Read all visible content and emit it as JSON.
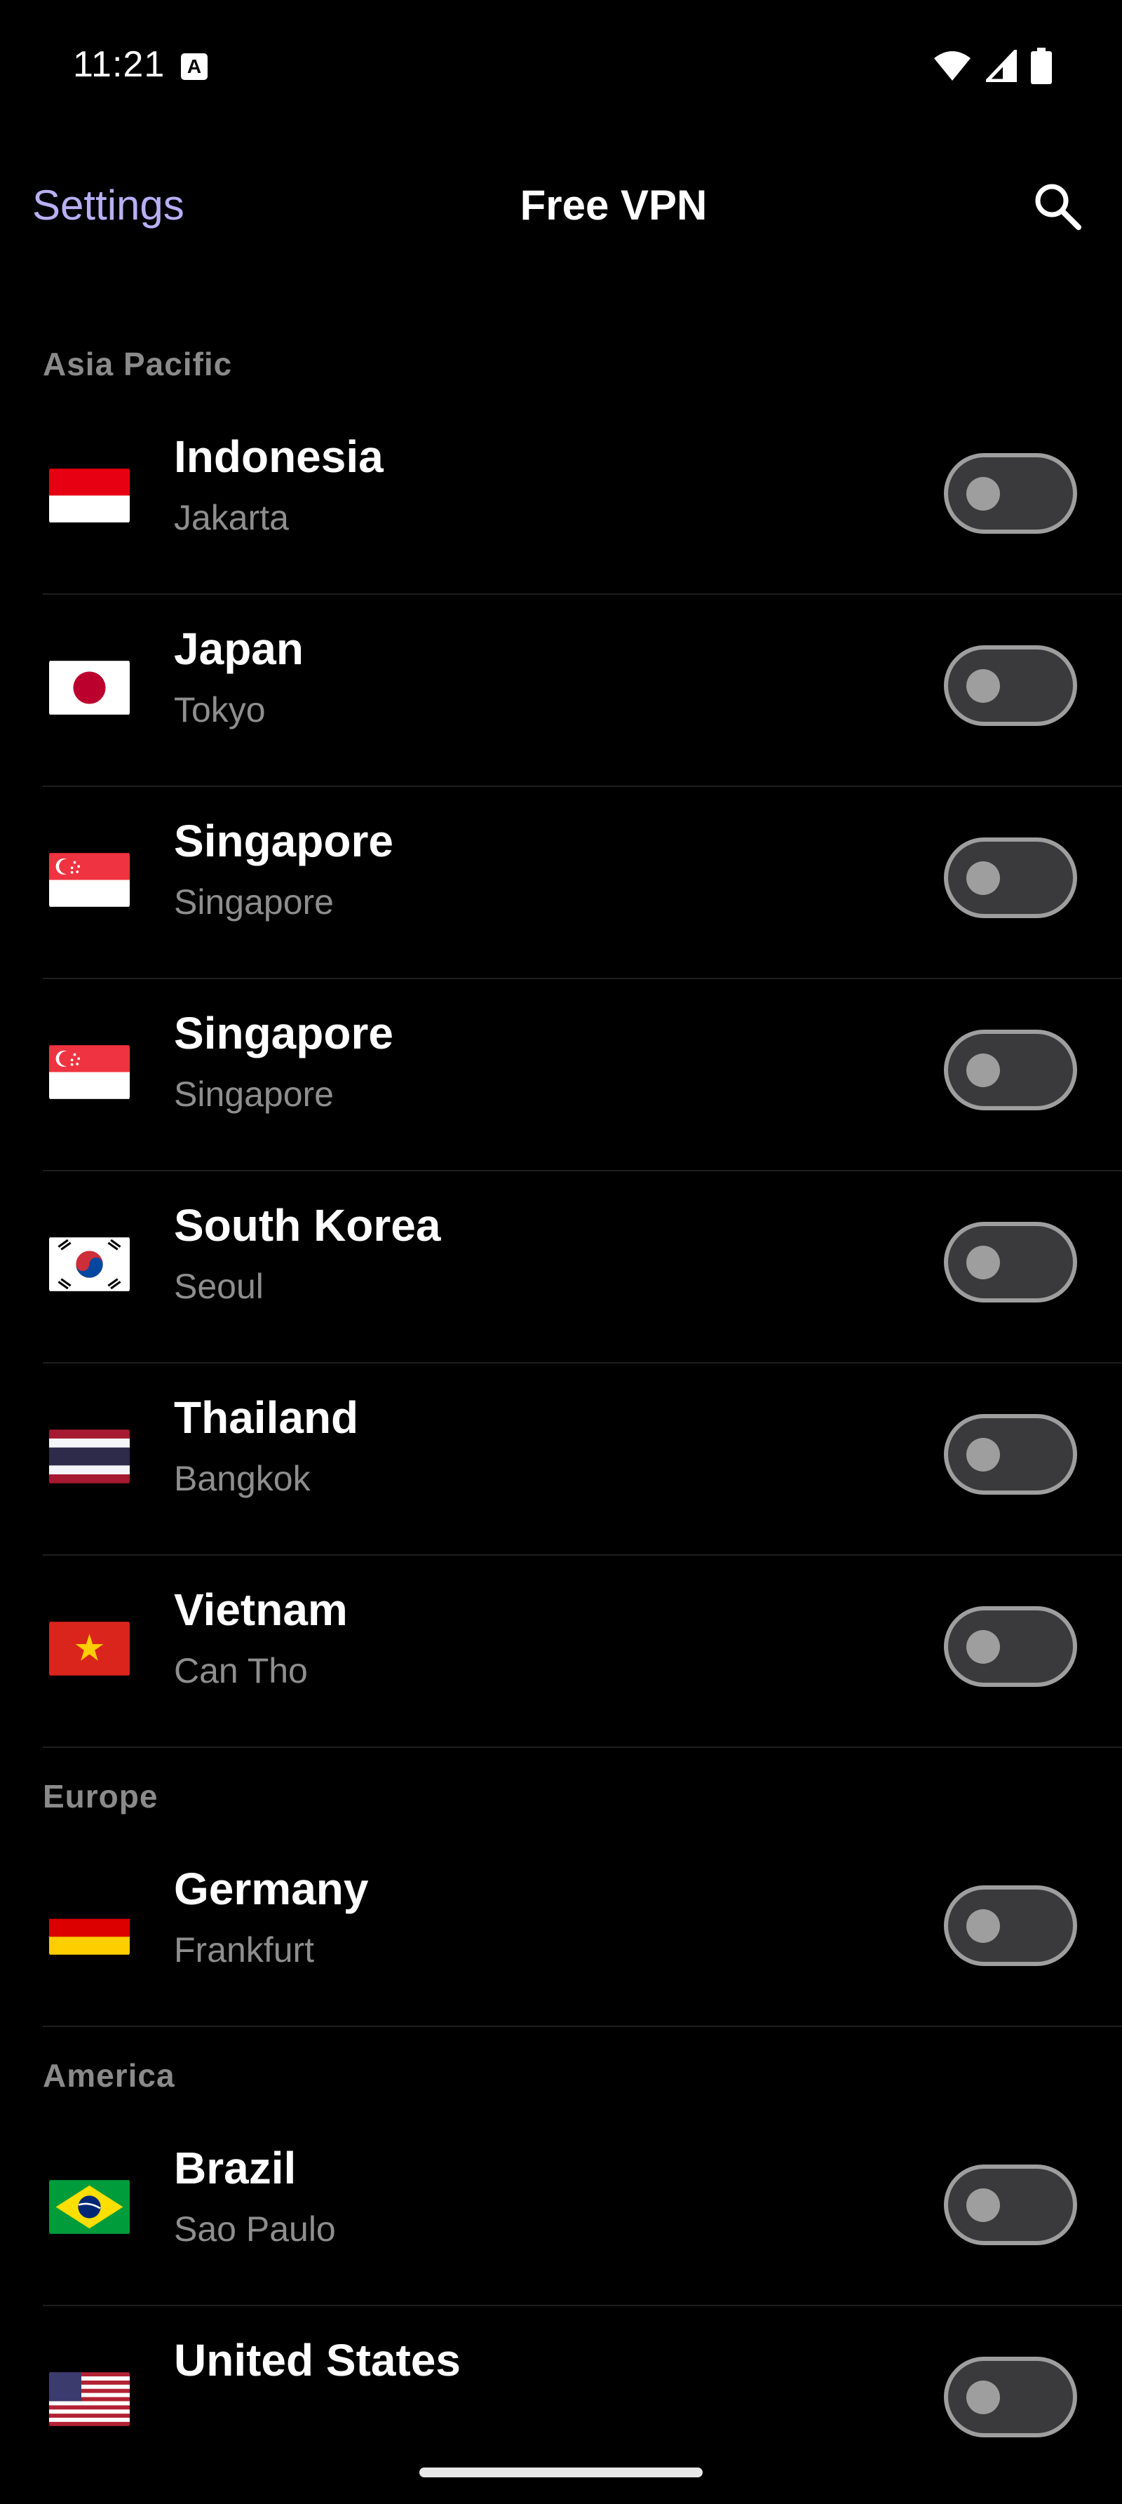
{
  "status_bar": {
    "time": "11:21",
    "notification_icon": "A"
  },
  "app_bar": {
    "back_label": "Settings",
    "title": "Free VPN",
    "search_icon": "search-icon"
  },
  "sections": [
    {
      "title": "Asia Pacific",
      "items": [
        {
          "country": "Indonesia",
          "city": "Jakarta",
          "flag": "indonesia-flag",
          "enabled": false
        },
        {
          "country": "Japan",
          "city": "Tokyo",
          "flag": "japan-flag",
          "enabled": false
        },
        {
          "country": "Singapore",
          "city": "Singapore",
          "flag": "singapore-flag",
          "enabled": false
        },
        {
          "country": "Singapore",
          "city": "Singapore",
          "flag": "singapore-flag",
          "enabled": false
        },
        {
          "country": "South Korea",
          "city": "Seoul",
          "flag": "south-korea-flag",
          "enabled": false
        },
        {
          "country": "Thailand",
          "city": "Bangkok",
          "flag": "thailand-flag",
          "enabled": false
        },
        {
          "country": "Vietnam",
          "city": "Can Tho",
          "flag": "vietnam-flag",
          "enabled": false
        }
      ]
    },
    {
      "title": "Europe",
      "items": [
        {
          "country": "Germany",
          "city": "Frankfurt",
          "flag": "germany-flag",
          "enabled": false
        }
      ]
    },
    {
      "title": "America",
      "items": [
        {
          "country": "Brazil",
          "city": "Sao Paulo",
          "flag": "brazil-flag",
          "enabled": false
        },
        {
          "country": "United States",
          "city": "",
          "flag": "united-states-flag",
          "enabled": false
        }
      ]
    }
  ],
  "colors": {
    "accent": "#b7b0f5",
    "background": "#000000",
    "secondary_text": "#8e8e8e",
    "toggle_off": "#9e9e9e"
  }
}
